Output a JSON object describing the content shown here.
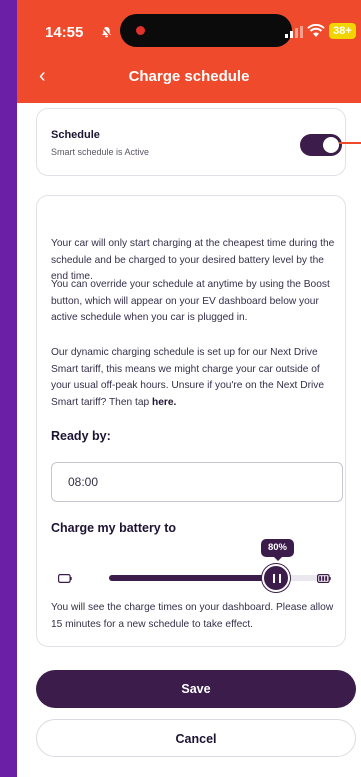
{
  "status_bar": {
    "time": "14:55",
    "battery": "38+",
    "icons": [
      "bell-slash-icon",
      "signal-icon",
      "wifi-icon",
      "battery-icon"
    ]
  },
  "header": {
    "title": "Charge schedule",
    "back_icon": "chevron-left-icon"
  },
  "schedule": {
    "title": "Schedule",
    "subtitle": "Smart schedule is Active",
    "toggle_on": true
  },
  "info": {
    "paragraph_1": "Your car will only start charging at the cheapest time during the schedule and be charged to your desired battery level by the end time.",
    "paragraph_2": "You can override your schedule at anytime by using the Boost button, which will appear on your EV dashboard below your active schedule when you car is plugged in.",
    "paragraph_3_text": "Our dynamic charging schedule is set up for our Next Drive Smart tariff, this means we might charge your car outside of your usual off-peak hours. Unsure if you're on the Next Drive Smart tariff? Then tap ",
    "paragraph_3_link": "here.",
    "ready_by_label": "Ready by:",
    "ready_by_value": "08:00",
    "charge_label": "Charge my battery to",
    "charge_percent_label": "80%",
    "charge_level": 0.8,
    "footer_note": "You will see the charge times on your dashboard. Please allow 15 minutes for a new schedule to take effect."
  },
  "actions": {
    "save_label": "Save",
    "cancel_label": "Cancel"
  },
  "colors": {
    "header": "#ee4a2b",
    "accent": "#3c1c4a",
    "background": "#6a1fa6"
  }
}
